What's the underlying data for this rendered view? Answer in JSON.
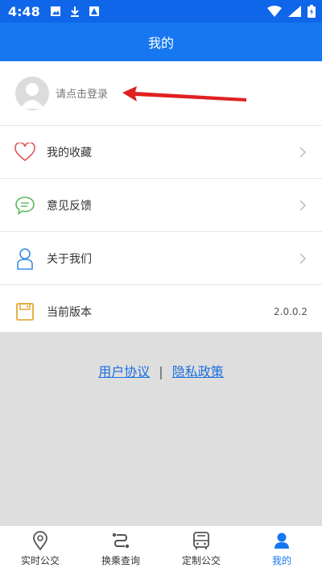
{
  "status_bar": {
    "time": "4:48"
  },
  "header": {
    "title": "我的"
  },
  "login": {
    "prompt": "请点击登录"
  },
  "menu": [
    {
      "label": "我的收藏",
      "icon": "heart-icon"
    },
    {
      "label": "意见反馈",
      "icon": "chat-icon"
    },
    {
      "label": "关于我们",
      "icon": "person-icon"
    },
    {
      "label": "当前版本",
      "icon": "save-icon",
      "value": "2.0.0.2"
    }
  ],
  "footer_links": {
    "user_agreement": "用户协议",
    "separator": "|",
    "privacy_policy": "隐私政策"
  },
  "tabs": [
    {
      "label": "实时公交",
      "icon": "location-pin-icon"
    },
    {
      "label": "换乘查询",
      "icon": "route-icon"
    },
    {
      "label": "定制公交",
      "icon": "bus-icon"
    },
    {
      "label": "我的",
      "icon": "user-icon",
      "active": true
    }
  ],
  "colors": {
    "primary": "#1677f0",
    "status_bar": "#0f66e8",
    "link": "#1a6fe0",
    "background": "#dedede",
    "arrow": "#e02020"
  }
}
